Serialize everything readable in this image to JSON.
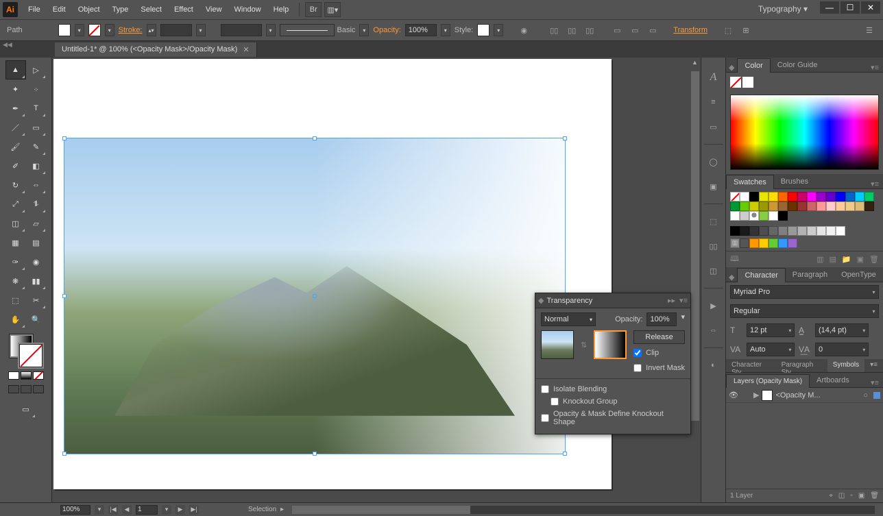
{
  "app": {
    "logo": "Ai"
  },
  "menu": [
    "File",
    "Edit",
    "Object",
    "Type",
    "Select",
    "Effect",
    "View",
    "Window",
    "Help"
  ],
  "workspace": "Typography",
  "controlbar": {
    "left_label": "Path",
    "stroke_label": "Stroke:",
    "brush_label": "Basic",
    "opacity_label": "Opacity:",
    "opacity_value": "100%",
    "style_label": "Style:",
    "transform_label": "Transform"
  },
  "tab": {
    "title": "Untitled-1* @ 100% (<Opacity Mask>/Opacity Mask)"
  },
  "transparency": {
    "title": "Transparency",
    "blend_mode": "Normal",
    "opacity_label": "Opacity:",
    "opacity_value": "100%",
    "release": "Release",
    "clip": "Clip",
    "clip_checked": true,
    "invert": "Invert Mask",
    "isolate": "Isolate Blending",
    "knockout_group": "Knockout Group",
    "define_knockout": "Opacity & Mask Define Knockout Shape"
  },
  "right": {
    "color_tab": "Color",
    "color_guide_tab": "Color Guide",
    "swatches_tab": "Swatches",
    "brushes_tab": "Brushes",
    "character_tab": "Character",
    "paragraph_tab": "Paragraph",
    "opentype_tab": "OpenType",
    "font_family": "Myriad Pro",
    "font_style": "Regular",
    "font_size": "12 pt",
    "leading": "(14,4 pt)",
    "kerning": "Auto",
    "tracking": "0",
    "char_styles_tab": "Character Sty",
    "para_styles_tab": "Paragraph Sty",
    "symbols_tab": "Symbols",
    "layers_tab": "Layers (Opacity Mask)",
    "artboards_tab": "Artboards",
    "layer_name": "<Opacity M...",
    "layer_count": "1 Layer"
  },
  "swatch_colors": [
    "none",
    "#ffffff",
    "#000000",
    "#e6e600",
    "#ffdd00",
    "#ff6600",
    "#ff0000",
    "#cc0066",
    "#ff00ff",
    "#9900cc",
    "#6600cc",
    "#0000ff",
    "#0066cc",
    "#00ccff",
    "#00cc66",
    "#009933",
    "#66cc00",
    "#cccc00",
    "#999900",
    "#cc9933",
    "#996633",
    "#663300",
    "#993333",
    "#cc6666",
    "#ff9999",
    "#ffcccc",
    "#ffcc99",
    "#eecc88",
    "#ddbb77",
    "#332211",
    "#ffffff",
    "#cccccc",
    "reg",
    "#88cc44",
    "#ffffff",
    "#000000"
  ],
  "gray_row": [
    "#000000",
    "#1a1a1a",
    "#333333",
    "#4d4d4d",
    "#666666",
    "#808080",
    "#999999",
    "#b3b3b3",
    "#cccccc",
    "#e6e6e6",
    "#f2f2f2",
    "#ffffff"
  ],
  "extra_row": [
    "#555555",
    "#ff9900",
    "#ffcc00",
    "#66cc33",
    "#3399ff",
    "#9966cc"
  ],
  "statusbar": {
    "zoom": "100%",
    "page": "1",
    "tool": "Selection"
  }
}
